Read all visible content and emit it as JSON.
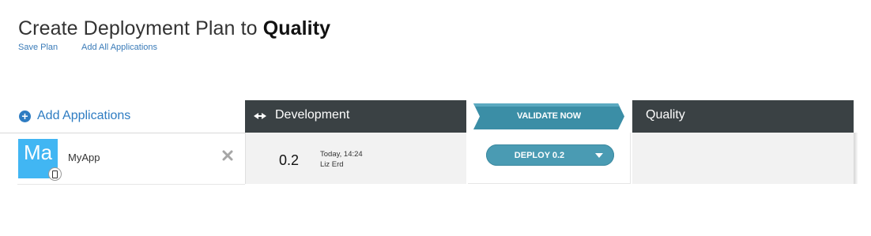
{
  "page": {
    "title_prefix": "Create Deployment Plan to",
    "title_env": "Quality"
  },
  "links": {
    "save_plan": "Save Plan",
    "add_all_applications": "Add All Applications"
  },
  "add_applications": {
    "label": "Add Applications",
    "icon": "plus-circle-icon"
  },
  "environments": {
    "source": {
      "label": "Development",
      "icon": "collapse-arrows-icon"
    },
    "validate_label": "VALIDATE NOW",
    "target": {
      "label": "Quality"
    }
  },
  "apps": [
    {
      "icon_text": "Ma",
      "name": "MyApp",
      "platform_icon": "mobile-device-icon",
      "remove_icon": "close-icon",
      "version": "0.2",
      "when": "Today, 14:24",
      "who": "Liz Erd",
      "deploy_label": "DEPLOY 0.2"
    }
  ],
  "colors": {
    "header_dark": "#3a4144",
    "accent_blue": "#2e7cc2",
    "validate_teal": "#3b8ea6",
    "deploy_teal": "#4a9bb3",
    "app_icon_bg": "#41b6f3"
  }
}
